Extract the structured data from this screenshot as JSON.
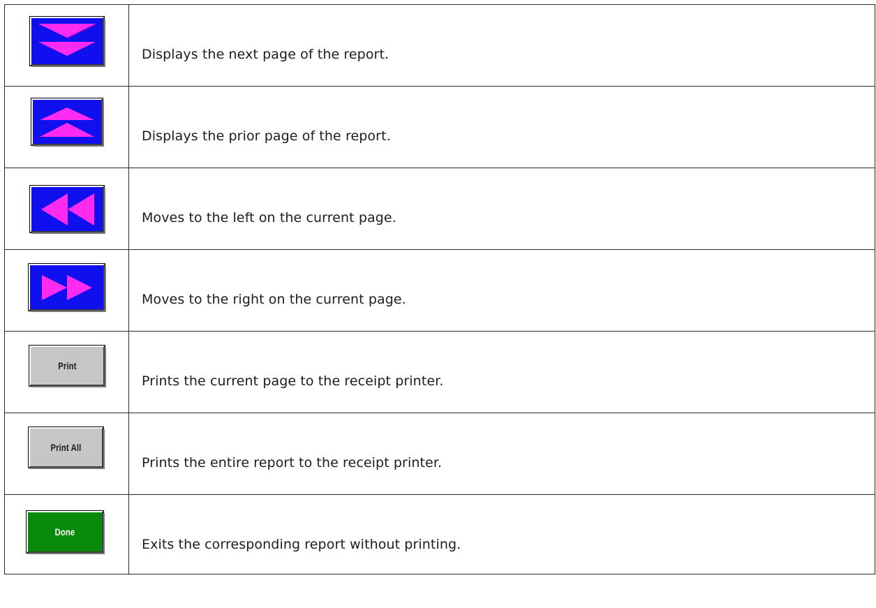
{
  "rows": [
    {
      "button": {
        "icon": "page-down-icon",
        "label": "",
        "style": "blue",
        "color": "#1010ee",
        "glyph_color": "#ff2bf0"
      },
      "description": "Displays the next page of the report."
    },
    {
      "button": {
        "icon": "page-up-icon",
        "label": "",
        "style": "blue",
        "color": "#1010ee",
        "glyph_color": "#ff2bf0"
      },
      "description": "Displays the prior page of the report."
    },
    {
      "button": {
        "icon": "scroll-left-icon",
        "label": "",
        "style": "blue",
        "color": "#1010ee",
        "glyph_color": "#ff2bf0"
      },
      "description": "Moves to the left on the current page."
    },
    {
      "button": {
        "icon": "scroll-right-icon",
        "label": "",
        "style": "blue",
        "color": "#1010ee",
        "glyph_color": "#ff2bf0"
      },
      "description": "Moves to the right on the current page."
    },
    {
      "button": {
        "icon": "",
        "label": "Print",
        "style": "gray",
        "color": "#c6c6c6"
      },
      "description": "Prints the current page to the receipt printer."
    },
    {
      "button": {
        "icon": "",
        "label": "Print All",
        "style": "gray",
        "color": "#c6c6c6"
      },
      "description": "Prints the entire report to the receipt printer."
    },
    {
      "button": {
        "icon": "",
        "label": "Done",
        "style": "green",
        "color": "#0a8a0a"
      },
      "description": "Exits the corresponding report without printing."
    }
  ]
}
